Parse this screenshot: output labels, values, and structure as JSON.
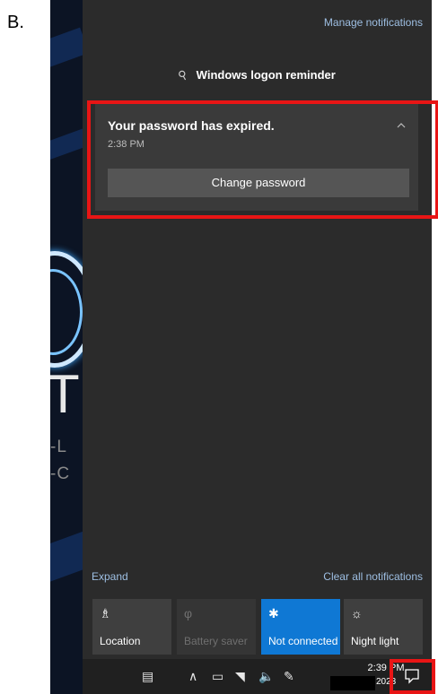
{
  "step_label": "B.",
  "action_center": {
    "manage_link": "Manage notifications",
    "group_header": "Windows logon reminder",
    "notification": {
      "title": "Your password has expired.",
      "time": "2:38 PM",
      "action_button": "Change password"
    },
    "expand_link": "Expand",
    "clear_all_link": "Clear all notifications",
    "quick_actions": [
      {
        "label": "Location",
        "icon": "location-icon",
        "state": "off"
      },
      {
        "label": "Battery saver",
        "icon": "battery-saver-icon",
        "state": "disabled"
      },
      {
        "label": "Not connected",
        "icon": "bluetooth-icon",
        "state": "on"
      },
      {
        "label": "Night light",
        "icon": "night-light-icon",
        "state": "off"
      }
    ]
  },
  "background": {
    "big_letter": "T",
    "line1": "-L",
    "line2": "-C"
  },
  "taskbar": {
    "time": "2:39 PM",
    "date_visible": "2023"
  },
  "colors": {
    "highlight": "#e81515",
    "accent": "#0f78d4",
    "panel": "#2b2b2b",
    "link": "#9ebfe3"
  }
}
